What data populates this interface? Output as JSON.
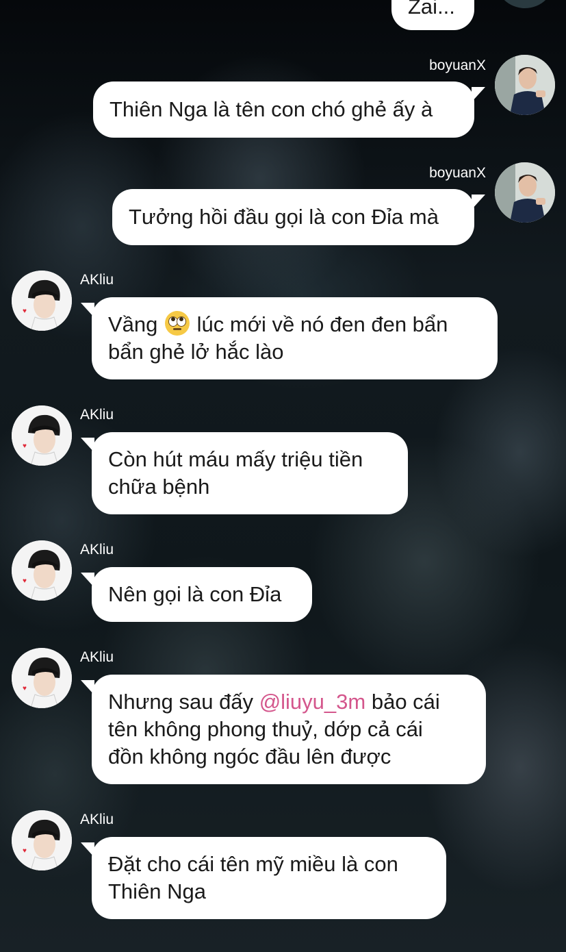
{
  "messages": [
    {
      "sender": "",
      "side": "right",
      "text": "Zai..."
    },
    {
      "sender": "boyuanX",
      "side": "right",
      "text": "Thiên Nga là tên con chó ghẻ ấy à"
    },
    {
      "sender": "boyuanX",
      "side": "right",
      "text": "Tưởng hồi đầu gọi là con Đỉa mà"
    },
    {
      "sender": "AKliu",
      "side": "left",
      "line1_before_emoji": "Vầng",
      "emoji": "face-with-rolling-eyes",
      "line1_after_emoji": "lúc mới về nó đen đen bẩn",
      "line2": "bẩn ghẻ lở hắc lào"
    },
    {
      "sender": "AKliu",
      "side": "left",
      "line1": "Còn hút máu mấy triệu tiền",
      "line2": "chữa bệnh"
    },
    {
      "sender": "AKliu",
      "side": "left",
      "text": "Nên gọi là con Đỉa"
    },
    {
      "sender": "AKliu",
      "side": "left",
      "line1_before_mention": "Nhưng sau đấy",
      "mention": "@liuyu_3m",
      "line1_after_mention": "bảo cái",
      "line2": "tên không phong thuỷ, dớp cả cái",
      "line3": "đồn không ngóc đầu lên được"
    },
    {
      "sender": "AKliu",
      "side": "left",
      "line1": "Đặt cho cái tên mỹ miều là con",
      "line2": "Thiên Nga"
    }
  ],
  "colors": {
    "bubble": "#ffffff",
    "mention": "#d4568c",
    "username": "#ffffff"
  }
}
